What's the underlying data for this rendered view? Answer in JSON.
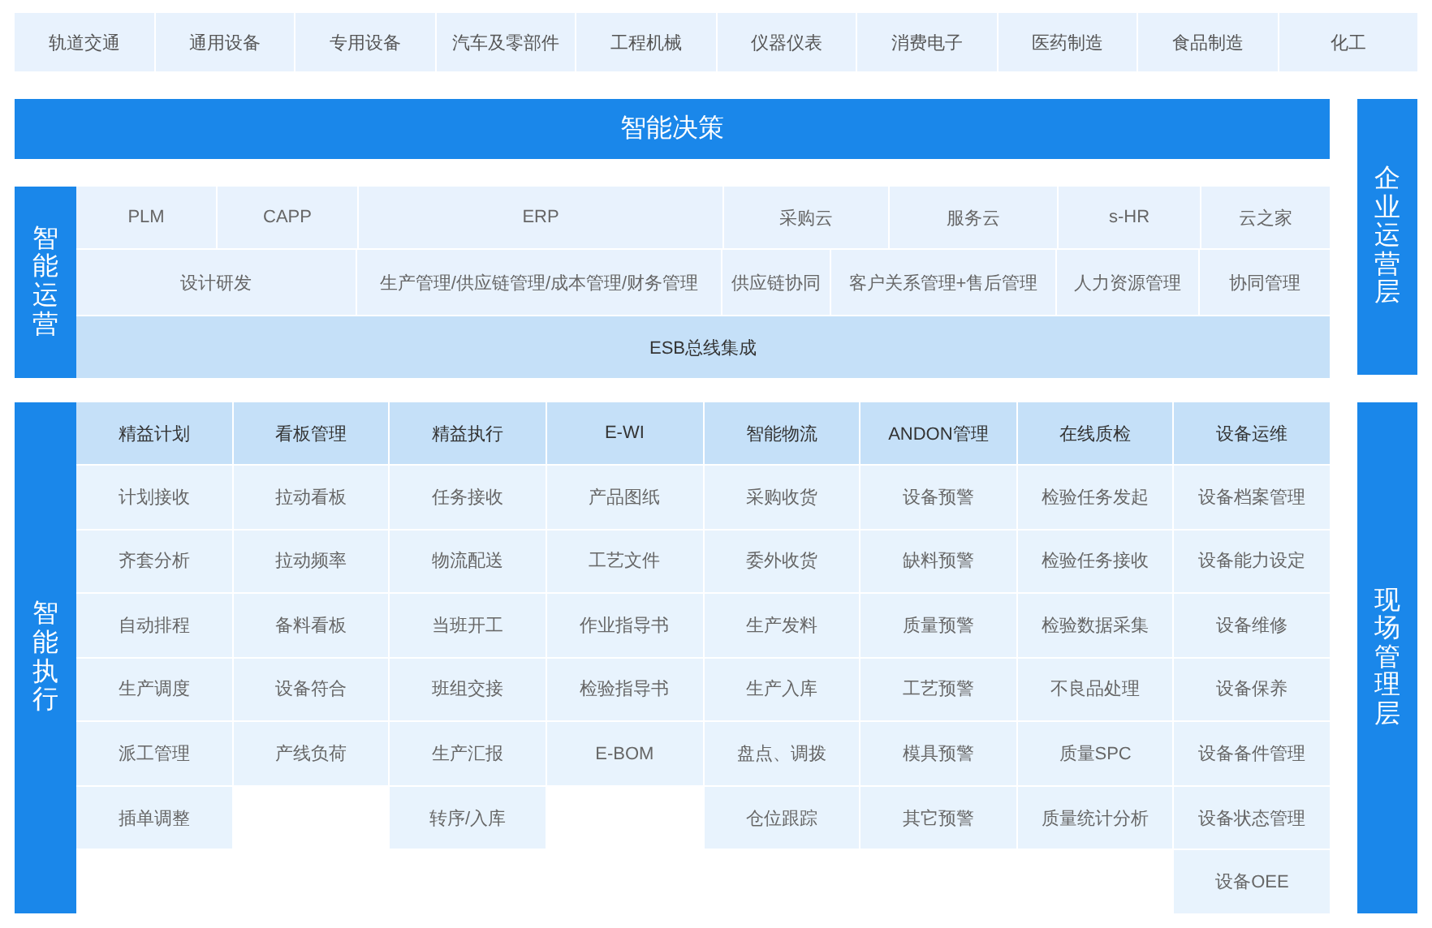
{
  "industries": [
    "轨道交通",
    "通用设备",
    "专用设备",
    "汽车及零部件",
    "工程机械",
    "仪器仪表",
    "消费电子",
    "医药制造",
    "食品制造",
    "化工"
  ],
  "decision": {
    "title": "智能决策"
  },
  "enterprise_layer": {
    "label": "企业运营层"
  },
  "operations": {
    "label": "智能运营",
    "systems": [
      "PLM",
      "CAPP",
      "ERP",
      "采购云",
      "服务云",
      "s-HR",
      "云之家"
    ],
    "functions": [
      "设计研发",
      "生产管理/供应链管理/成本管理/财务管理",
      "供应链协同",
      "客户关系管理+售后管理",
      "人力资源管理",
      "协同管理"
    ],
    "bus": "ESB总线集成"
  },
  "execution": {
    "label": "智能执行",
    "modules": [
      {
        "header": "精益计划",
        "items": [
          "计划接收",
          "齐套分析",
          "自动排程",
          "生产调度",
          "派工管理",
          "插单调整"
        ]
      },
      {
        "header": "看板管理",
        "items": [
          "拉动看板",
          "拉动频率",
          "备料看板",
          "设备符合",
          "产线负荷"
        ]
      },
      {
        "header": "精益执行",
        "items": [
          "任务接收",
          "物流配送",
          "当班开工",
          "班组交接",
          "生产汇报",
          "转序/入库"
        ]
      },
      {
        "header": "E-WI",
        "items": [
          "产品图纸",
          "工艺文件",
          "作业指导书",
          "检验指导书",
          "E-BOM"
        ]
      },
      {
        "header": "智能物流",
        "items": [
          "采购收货",
          "委外收货",
          "生产发料",
          "生产入库",
          "盘点、调拨",
          "仓位跟踪"
        ]
      },
      {
        "header": "ANDON管理",
        "items": [
          "设备预警",
          "缺料预警",
          "质量预警",
          "工艺预警",
          "模具预警",
          "其它预警"
        ]
      },
      {
        "header": "在线质检",
        "items": [
          "检验任务发起",
          "检验任务接收",
          "检验数据采集",
          "不良品处理",
          "质量SPC",
          "质量统计分析"
        ]
      },
      {
        "header": "设备运维",
        "items": [
          "设备档案管理",
          "设备能力设定",
          "设备维修",
          "设备保养",
          "设备备件管理",
          "设备状态管理",
          "设备OEE"
        ]
      }
    ]
  },
  "field_layer": {
    "label": "现场管理层"
  }
}
